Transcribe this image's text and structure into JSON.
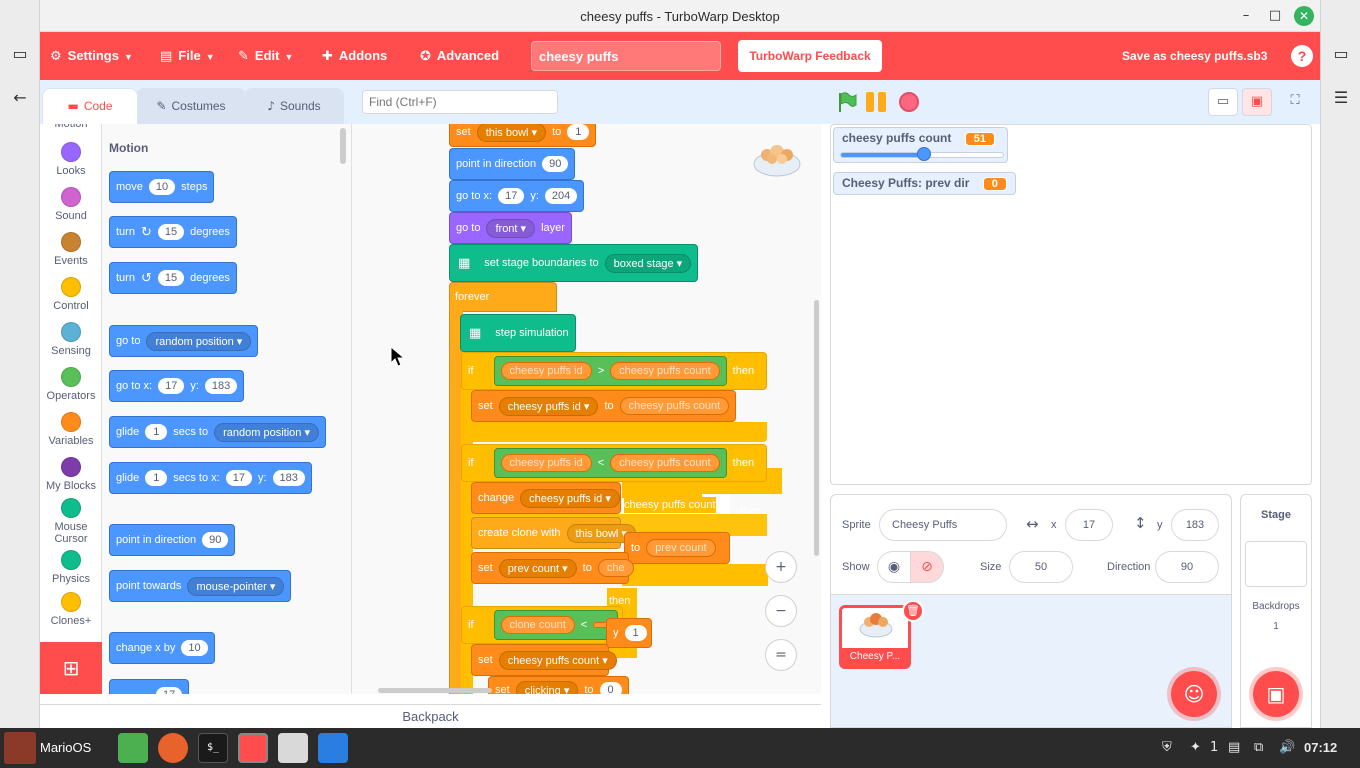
{
  "window": {
    "title": "cheesy puffs - TurboWarp Desktop",
    "minimize": "–",
    "maximize": "□",
    "close": "✕"
  },
  "menubar": {
    "settings": "Settings",
    "file": "File",
    "edit": "Edit",
    "addons": "Addons",
    "advanced": "Advanced",
    "project_title": "cheesy puffs",
    "feedback": "TurboWarp Feedback",
    "save_as": "Save as cheesy puffs.sb3",
    "help": "?"
  },
  "tabs": {
    "code": "Code",
    "costumes": "Costumes",
    "sounds": "Sounds"
  },
  "find": {
    "placeholder": "Find (Ctrl+F)"
  },
  "categories": [
    {
      "label": "Motion",
      "color": "#4c97ff"
    },
    {
      "label": "Looks",
      "color": "#9966ff"
    },
    {
      "label": "Sound",
      "color": "#cf63cf"
    },
    {
      "label": "Events",
      "color": "#c88330"
    },
    {
      "label": "Control",
      "color": "#ffbf00"
    },
    {
      "label": "Sensing",
      "color": "#5cb1d6"
    },
    {
      "label": "Operators",
      "color": "#59c059"
    },
    {
      "label": "Variables",
      "color": "#ff8c1a"
    },
    {
      "label": "My Blocks",
      "color": "#7e3bab"
    },
    {
      "label": "Mouse Cursor",
      "color": "#0fbd8c"
    },
    {
      "label": "Physics",
      "color": "#0fbd8c"
    },
    {
      "label": "Clones+",
      "color": "#ffbf00"
    }
  ],
  "palette": {
    "title": "Motion",
    "move": {
      "a": "move",
      "n": "10",
      "b": "steps"
    },
    "turn_right": {
      "a": "turn",
      "n": "15",
      "b": "degrees"
    },
    "turn_left": {
      "a": "turn",
      "n": "15",
      "b": "degrees"
    },
    "goto": {
      "a": "go to",
      "d": "random position"
    },
    "goto_xy": {
      "a": "go to x:",
      "x": "17",
      "b": "y:",
      "y": "183"
    },
    "glide": {
      "a": "glide",
      "n": "1",
      "b": "secs to",
      "d": "random position"
    },
    "glide_xy": {
      "a": "glide",
      "n": "1",
      "b": "secs to x:",
      "x": "17",
      "c": "y:",
      "y": "183"
    },
    "point_dir": {
      "a": "point in direction",
      "n": "90"
    },
    "point_towards": {
      "a": "point towards",
      "d": "mouse-pointer"
    },
    "change_x": {
      "a": "change x by",
      "n": "10"
    },
    "set_x_partial": {
      "n": "17"
    }
  },
  "script": {
    "set_bowl": {
      "a": "set",
      "d": "this bowl",
      "b": "to",
      "n": "1"
    },
    "point_dir": {
      "a": "point in direction",
      "n": "90"
    },
    "goto_xy": {
      "a": "go to x:",
      "x": "17",
      "b": "y:",
      "y": "204"
    },
    "goto_layer": {
      "a": "go to",
      "d": "front",
      "b": "layer"
    },
    "boundaries": {
      "a": "set stage boundaries to",
      "d": "boxed stage"
    },
    "forever": "forever",
    "step": "step simulation",
    "if1": {
      "a": "if",
      "l": "cheesy puffs id",
      "op": ">",
      "r": "cheesy puffs count",
      "b": "then"
    },
    "set_id": {
      "a": "set",
      "d": "cheesy puffs id",
      "b": "to",
      "r": "cheesy puffs count"
    },
    "if2": {
      "a": "if",
      "l": "cheesy puffs id",
      "op": "<",
      "r": "cheesy puffs count",
      "b": "then"
    },
    "change_id": {
      "a": "change",
      "d": "cheesy puffs id"
    },
    "ghost_count": "cheesy puffs count",
    "ghost_then": "then",
    "create_clone": {
      "a": "create clone with",
      "d": "this bowl"
    },
    "ghost_to": "to",
    "ghost_prev": "prev count",
    "set_prev": {
      "a": "set",
      "d": "prev count",
      "b": "to",
      "r": "che"
    },
    "then3": "then",
    "if3": {
      "a": "if",
      "l": "clone count",
      "op": "<",
      "r": ""
    },
    "ghost_y": "y",
    "ghost_one": "1",
    "set_count": {
      "a": "set",
      "d": "cheesy puffs count"
    },
    "set_clicking": {
      "a": "set",
      "d": "clicking",
      "b": "to",
      "n": "0"
    }
  },
  "zoom": {
    "in": "+",
    "out": "−",
    "reset": "="
  },
  "backpack": "Backpack",
  "monitors": {
    "count": {
      "label": "cheesy puffs count",
      "value": "51",
      "slider": 0.51
    },
    "prevdir": {
      "label": "Cheesy Puffs: prev dir",
      "value": "0"
    }
  },
  "sprite_info": {
    "sprite_label": "Sprite",
    "sprite_name": "Cheesy Puffs",
    "x_label": "x",
    "x": "17",
    "y_label": "y",
    "y": "183",
    "show_label": "Show",
    "size_label": "Size",
    "size": "50",
    "direction_label": "Direction",
    "direction": "90",
    "tile_label": "Cheesy P..."
  },
  "stage_pane": {
    "title": "Stage",
    "backdrops_label": "Backdrops",
    "backdrops_count": "1"
  },
  "taskbar": {
    "os_label": "MarioOS",
    "notif_count": "1",
    "time": "07:12"
  }
}
